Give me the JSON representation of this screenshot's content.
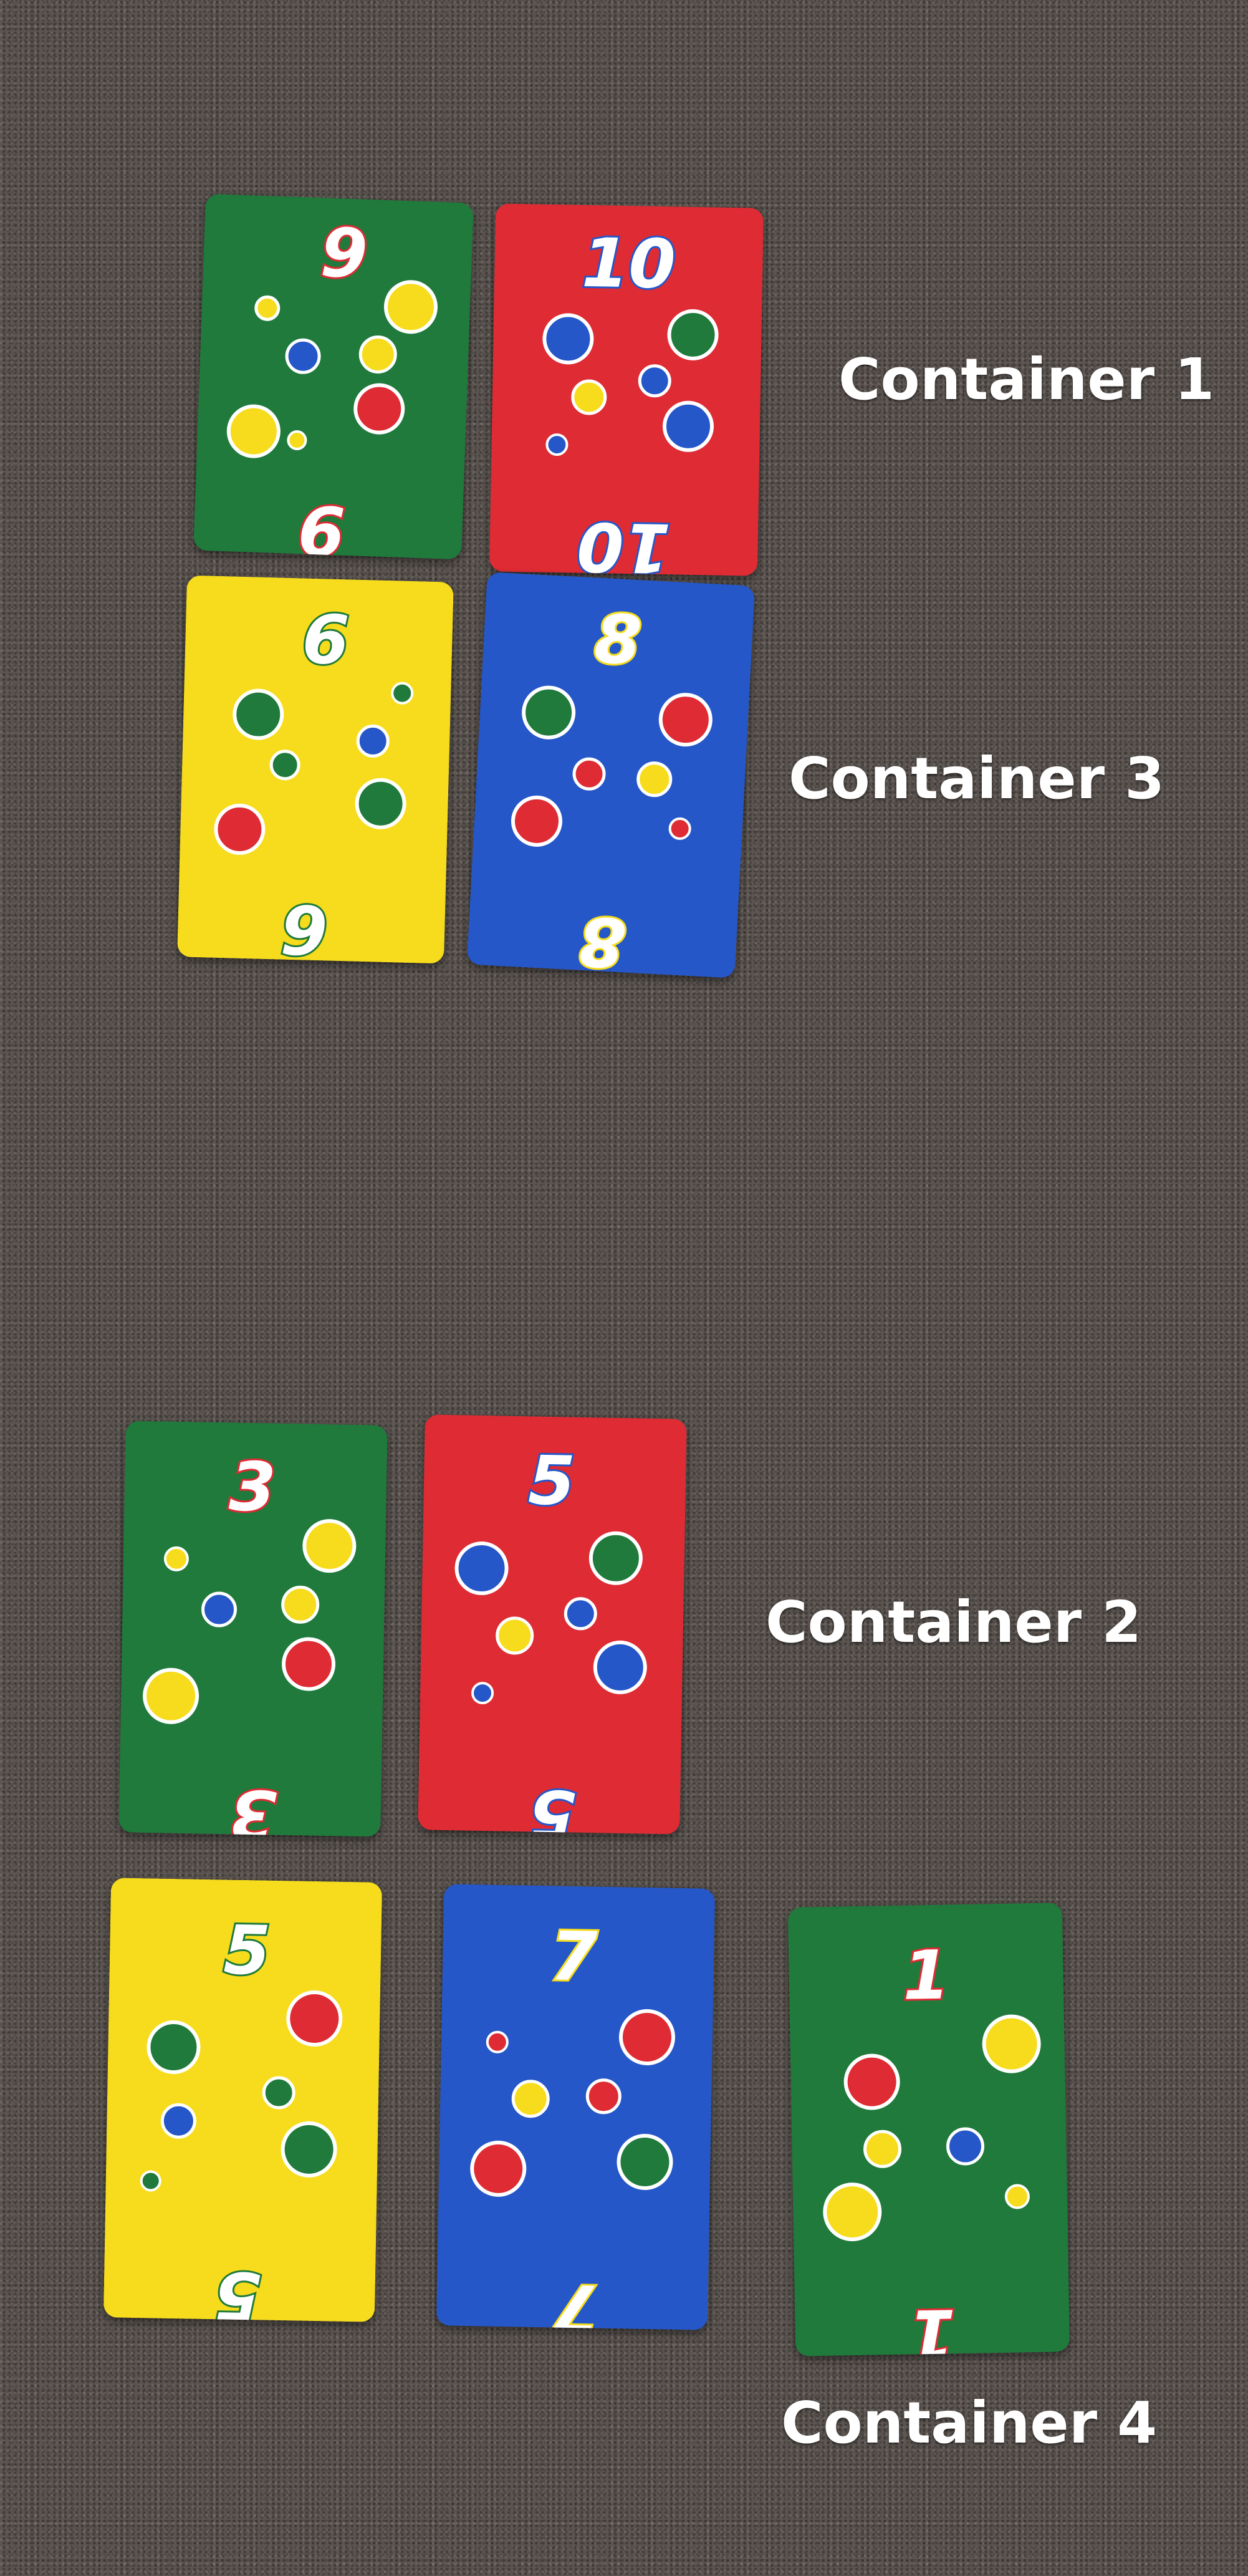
{
  "labels": {
    "container_1": "Container 1",
    "container_2": "Container 2",
    "container_3": "Container 3",
    "container_4": "Container 4"
  },
  "colors": {
    "green": "#1f7a3c",
    "red": "#de2b34",
    "yellow": "#f6dc1c",
    "blue": "#2557c9",
    "carpet": "#5b5450"
  },
  "cards": [
    {
      "id": "c1a",
      "group": "Container 1",
      "color": "green",
      "value": "9",
      "accent": "red"
    },
    {
      "id": "c1b",
      "group": "Container 1",
      "color": "red",
      "value": "10",
      "accent": "blue"
    },
    {
      "id": "c3a",
      "group": "Container 3",
      "color": "yellow",
      "value": "6",
      "accent": "green"
    },
    {
      "id": "c3b",
      "group": "Container 3",
      "color": "blue",
      "value": "8",
      "accent": "yellow"
    },
    {
      "id": "c2a",
      "group": "Container 2",
      "color": "green",
      "value": "3",
      "accent": "red"
    },
    {
      "id": "c2b",
      "group": "Container 2",
      "color": "red",
      "value": "5",
      "accent": "blue"
    },
    {
      "id": "c4a",
      "group": "Container 4",
      "color": "yellow",
      "value": "5",
      "accent": "green"
    },
    {
      "id": "c4b",
      "group": "Container 4",
      "color": "blue",
      "value": "7",
      "accent": "yellow"
    },
    {
      "id": "c4c",
      "group": "Container 4",
      "color": "green",
      "value": "1",
      "accent": "red"
    }
  ]
}
